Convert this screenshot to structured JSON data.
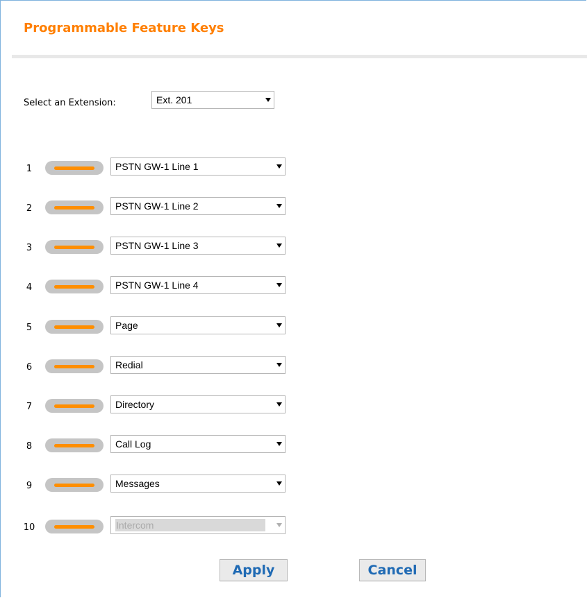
{
  "page": {
    "title": "Programmable Feature Keys"
  },
  "extension": {
    "label": "Select an Extension:",
    "selected": "Ext. 201"
  },
  "keys": [
    {
      "number": "1",
      "value": "PSTN GW-1 Line 1"
    },
    {
      "number": "2",
      "value": "PSTN GW-1 Line 2"
    },
    {
      "number": "3",
      "value": "PSTN GW-1 Line 3"
    },
    {
      "number": "4",
      "value": "PSTN GW-1 Line 4"
    },
    {
      "number": "5",
      "value": "Page"
    },
    {
      "number": "6",
      "value": "Redial"
    },
    {
      "number": "7",
      "value": "Directory"
    },
    {
      "number": "8",
      "value": "Call Log"
    },
    {
      "number": "9",
      "value": "Messages"
    },
    {
      "number": "10",
      "value": "Intercom",
      "disabled": true
    }
  ],
  "buttons": {
    "apply": "Apply",
    "cancel": "Cancel"
  },
  "colors": {
    "title": "#ff7f00",
    "led": "#ff8e00",
    "key_body": "#c5c5c5",
    "button_text": "#1f6ab4"
  }
}
